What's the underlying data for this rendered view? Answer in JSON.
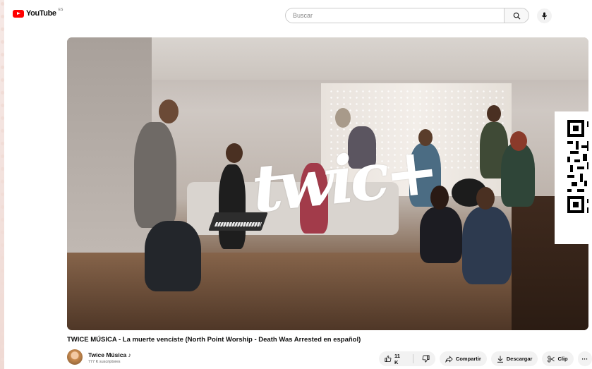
{
  "header": {
    "logo_text": "YouTube",
    "country_code": "ES",
    "search_placeholder": "Buscar",
    "icons": [
      "youtube-logo-icon",
      "search-icon",
      "mic-icon"
    ]
  },
  "video": {
    "overlay_logo": "twic+"
  },
  "info": {
    "title": "TWICE MÚSICA - La muerte venciste (North Point Worship - Death Was Arrested en español)",
    "channel_name": "Twice Música ♪",
    "subscribers": "777 K suscriptores"
  },
  "actions": {
    "likes": "11 K",
    "share": "Compartir",
    "download": "Descargar",
    "clip": "Clip",
    "more": "···"
  },
  "colors": {
    "brand": "#ff0000",
    "pill_bg": "#f2f2f2",
    "text": "#0f0f0f"
  }
}
